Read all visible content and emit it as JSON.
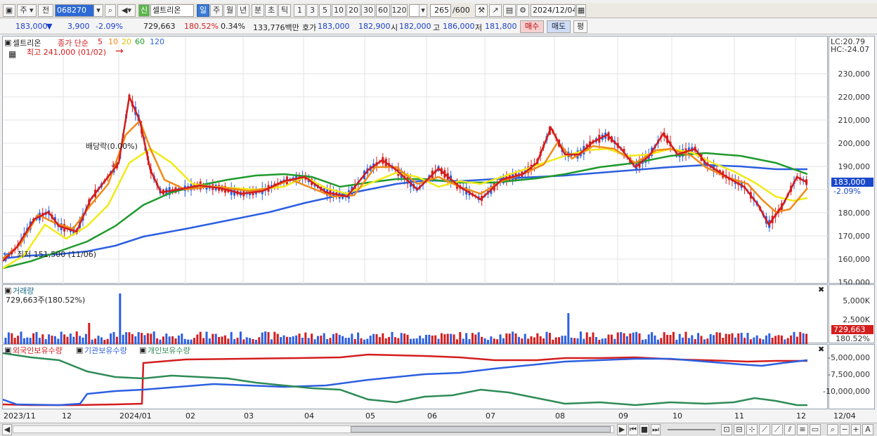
{
  "toolbar": {
    "mode1": "주",
    "mode2": "전",
    "code": "068270",
    "stock_name": "셀트리온",
    "new_badge": "신",
    "periods": [
      "일",
      "주",
      "월",
      "년",
      "분",
      "초",
      "틱"
    ],
    "minute_options": [
      "1",
      "3",
      "5",
      "10",
      "20",
      "30",
      "60",
      "120"
    ],
    "count": "265",
    "count_total": "/600",
    "date": "2024/12/04"
  },
  "quote": {
    "price": "183,000",
    "arrow": "▼",
    "change": "3,900",
    "change_rate": "-2.09%",
    "volume": "729,663",
    "volume_rate": "180.52%",
    "turnover": "0.34%",
    "amount": "133,776백만",
    "ask_label": "호가",
    "ask1": "183,000",
    "ask2": "182,900",
    "open_label": "시",
    "open": "182,000",
    "high_label": "고",
    "high": "186,000",
    "low_label": "저",
    "low": "181,800",
    "buy_label": "매수",
    "sell_label": "매도",
    "avg_label": "평"
  },
  "price_pane": {
    "title": "셀트리온",
    "ma_label": "종가 단순",
    "ma_periods": [
      "5",
      "10",
      "20",
      "60",
      "120"
    ],
    "ma_colors": [
      "#d41d1d",
      "#f08a16",
      "#e8e800",
      "#1f9a2d",
      "#2c5fe0"
    ],
    "high_marker": "최고 241,000 (01/02)",
    "low_marker": "최저 151,500 (11/06)",
    "dividend_marker": "배당락(0.00%)",
    "lc": "LC:20.79",
    "hc": "HC:-24.07",
    "y_ticks": [
      "230,000",
      "220,000",
      "210,000",
      "200,000",
      "190,000",
      "180,000",
      "170,000",
      "160,000",
      "150,000"
    ],
    "current_price_tag": "183,000",
    "current_rate_tag": "-2.09%"
  },
  "volume_pane": {
    "title": "거래량",
    "value": "729,663주(180.52%)",
    "y_ticks": [
      "5,000K",
      "2,500K"
    ],
    "tag_value": "729,663",
    "tag_rate": "180.52%"
  },
  "holding_pane": {
    "legend": [
      "외국인보유수량",
      "기관보유수량",
      "개인보유수량"
    ],
    "legend_colors": [
      "#d41d1d",
      "#2c5fe0",
      "#2e8b57"
    ],
    "y_ticks": [
      "-5,000,000",
      "-7,500,000",
      "-10,000,000"
    ]
  },
  "x_axis": [
    "2023/11",
    "12",
    "2024/01",
    "02",
    "03",
    "04",
    "05",
    "06",
    "07",
    "08",
    "09",
    "10",
    "11",
    "12",
    "12/04"
  ],
  "chart_data": {
    "type": "line",
    "title": "셀트리온",
    "x": [
      "2023/11",
      "12",
      "2024/01",
      "02",
      "03",
      "04",
      "05",
      "06",
      "07",
      "08",
      "09",
      "10",
      "11",
      "12"
    ],
    "series": [
      {
        "name": "종가",
        "values": [
          151500,
          163000,
          210000,
          180000,
          177000,
          181000,
          190000,
          180000,
          182000,
          205000,
          203000,
          197000,
          170000,
          183000
        ]
      },
      {
        "name": "120",
        "values": [
          151500,
          154000,
          158000,
          164000,
          170000,
          174000,
          180000,
          183000,
          184000,
          186000,
          188000,
          190000,
          189000,
          188000
        ]
      }
    ],
    "ylim": [
      145000,
      235000
    ]
  }
}
